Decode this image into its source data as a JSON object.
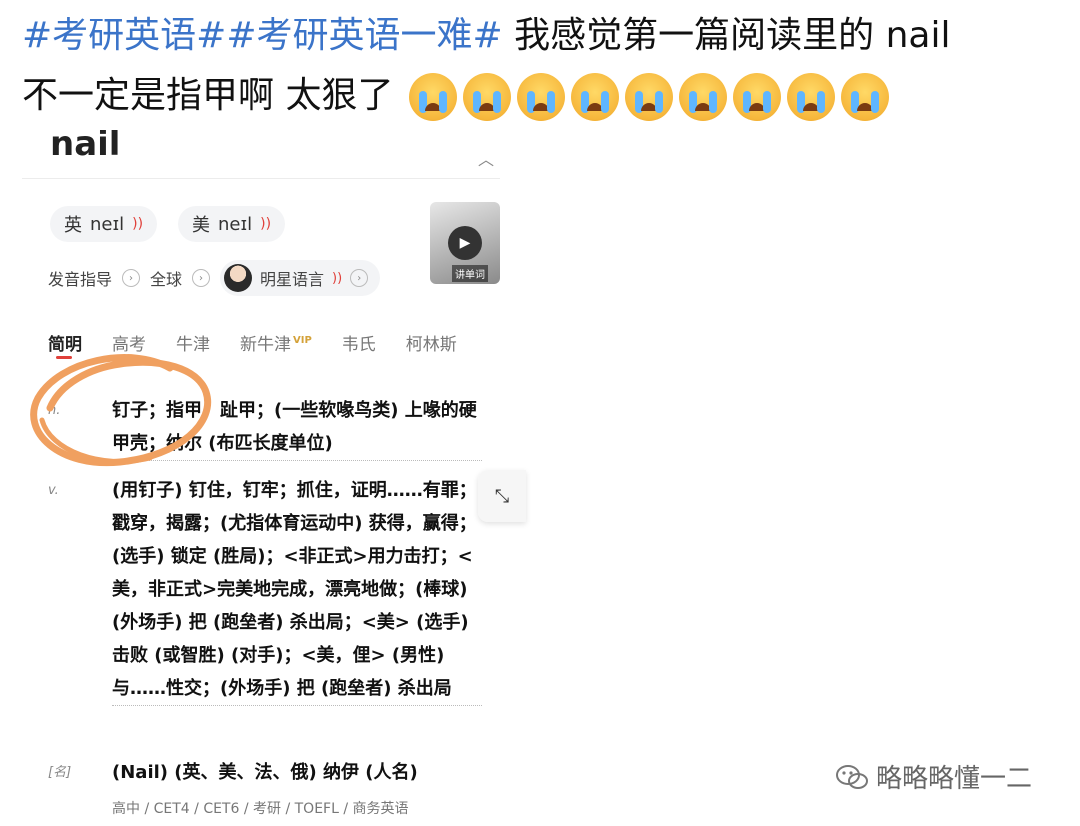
{
  "post": {
    "tag1": "#考研英语#",
    "tag2": "#考研英语一难#",
    "text_line1": " 我感觉第一篇阅读里的 nail",
    "text_line2": "不一定是指甲啊 太狠了"
  },
  "dict": {
    "word": "nail",
    "pron_uk_label": "英",
    "pron_uk": "neɪl",
    "pron_us_label": "美",
    "pron_us": "neɪl",
    "guide_label": "发音指导",
    "global_label": "全球",
    "star_label": "明星语言",
    "video_label": "讲单词",
    "tabs": [
      "简明",
      "高考",
      "牛津",
      "新牛津",
      "韦氏",
      "柯林斯"
    ],
    "tab_vip": "VIP",
    "entries": [
      {
        "pos": "n.",
        "def": "钉子；指甲，趾甲；(一些软喙鸟类) 上喙的硬甲壳；纳尔 (布匹长度单位)"
      },
      {
        "pos": "v.",
        "def": "(用钉子) 钉住，钉牢；抓住，证明……有罪；戳穿，揭露；(尤指体育运动中) 获得，赢得；(选手) 锁定 (胜局)；<非正式>用力击打；<美，非正式>完美地完成，漂亮地做；(棒球) (外场手) 把 (跑垒者) 杀出局；<美> (选手) 击败 (或智胜) (对手)；<美，俚> (男性) 与……性交；(外场手) 把 (跑垒者) 杀出局"
      },
      {
        "pos": "[名]",
        "def": "(Nail) (英、美、法、俄) 纳伊 (人名)"
      }
    ],
    "levels": "高中 / CET4 / CET6 / 考研 / TOEFL / 商务英语"
  },
  "watermark": {
    "text": "略略略懂一二"
  },
  "colors": {
    "hashtag": "#3b74c9",
    "annotation_circle": "#f0a060",
    "sound_icon": "#e0403a"
  }
}
